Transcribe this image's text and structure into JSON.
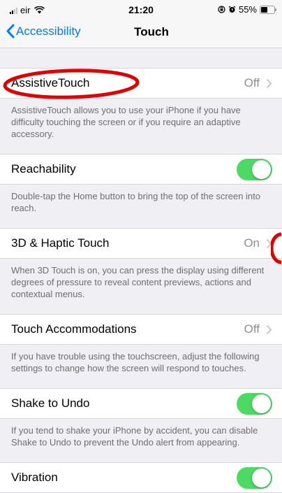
{
  "status": {
    "carrier": "eir",
    "time": "21:20",
    "battery": "55%",
    "battery_level": 0.55
  },
  "nav": {
    "back_label": "Accessibility",
    "title": "Touch"
  },
  "settings": [
    {
      "label": "AssistiveTouch",
      "value": "Off",
      "control": "disclosure",
      "footer": "AssistiveTouch allows you to use your iPhone if you have difficulty touching the screen or if you require an adaptive accessory."
    },
    {
      "label": "Reachability",
      "value": "",
      "control": "toggle",
      "on": true,
      "footer": "Double-tap the Home button to bring the top of the screen into reach."
    },
    {
      "label": "3D & Haptic Touch",
      "value": "On",
      "control": "disclosure",
      "footer": "When 3D Touch is on, you can press the display using different degrees of pressure to reveal content previews, actions and contextual menus."
    },
    {
      "label": "Touch Accommodations",
      "value": "Off",
      "control": "disclosure",
      "footer": "If you have trouble using the touchscreen, adjust the following settings to change how the screen will respond to touches."
    },
    {
      "label": "Shake to Undo",
      "value": "",
      "control": "toggle",
      "on": true,
      "footer": "If you tend to shake your iPhone by accident, you can disable Shake to Undo to prevent the Undo alert from appearing."
    },
    {
      "label": "Vibration",
      "value": "",
      "control": "toggle",
      "on": true,
      "footer": ""
    }
  ],
  "colors": {
    "accent": "#007aff",
    "toggle_on": "#4cd964",
    "annotation": "#e00000"
  },
  "icons": {
    "back": "chevron-left-icon",
    "disclosure": "chevron-right-icon",
    "wifi": "wifi-icon",
    "lock": "orientation-lock-icon",
    "alarm": "alarm-icon"
  }
}
